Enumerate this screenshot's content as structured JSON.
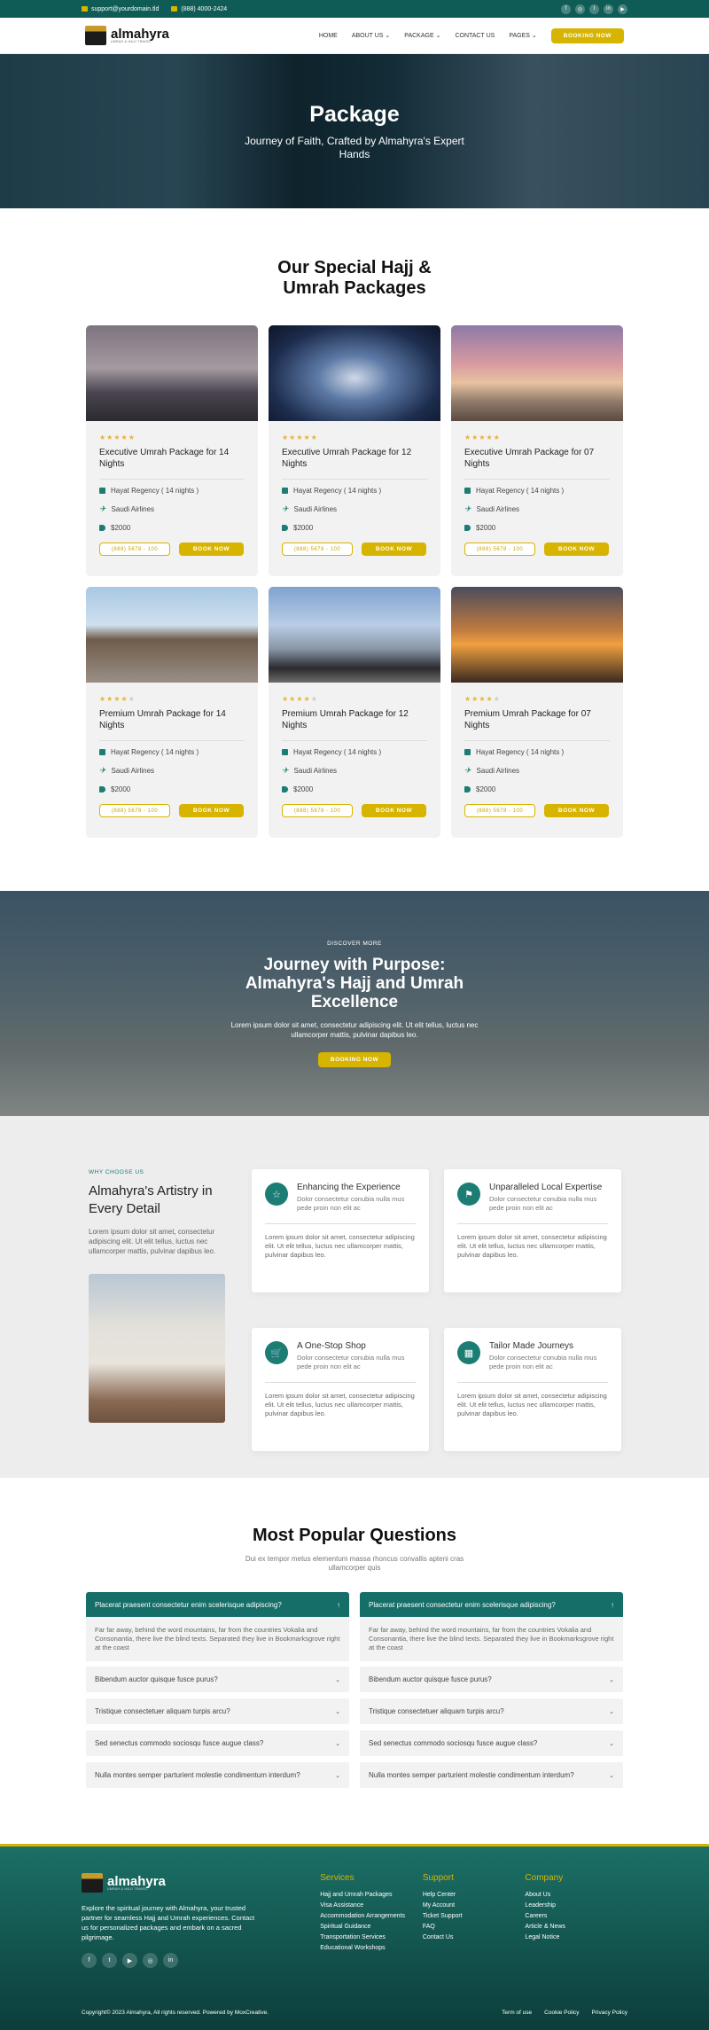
{
  "topbar": {
    "email": "support@yourdomain.tld",
    "phone": "(888) 4000-2424",
    "social": [
      "f",
      "◎",
      "t",
      "in",
      "▶"
    ]
  },
  "nav": {
    "brand": "almahyra",
    "tagline": "UMRAH & HAJJ TRAVEL",
    "items": [
      "HOME",
      "ABOUT US",
      "PACKAGE",
      "CONTACT US",
      "PAGES"
    ],
    "cta": "BOOKING NOW"
  },
  "hero": {
    "title": "Package",
    "subtitle": "Journey of Faith, Crafted by Almahyra's Expert Hands"
  },
  "packages": {
    "title": "Our Special Hajj & Umrah Packages",
    "cards": [
      {
        "stars": "★★★★★",
        "stars_off": "",
        "title": "Executive Umrah Package for 14 Nights",
        "hotel": "Hayat Regency ( 14 nights )",
        "airline": "Saudi Airlines",
        "price": "$2000",
        "phone": "(888) 5678 - 100",
        "book": "BOOK NOW"
      },
      {
        "stars": "★★★★★",
        "stars_off": "",
        "title": "Executive Umrah Package for 12 Nights",
        "hotel": "Hayat Regency ( 14 nights )",
        "airline": "Saudi Airlines",
        "price": "$2000",
        "phone": "(888) 5678 - 100",
        "book": "BOOK NOW"
      },
      {
        "stars": "★★★★★",
        "stars_off": "",
        "title": "Executive Umrah Package for 07 Nights",
        "hotel": "Hayat Regency ( 14 nights )",
        "airline": "Saudi Airlines",
        "price": "$2000",
        "phone": "(888) 5678 - 100",
        "book": "BOOK NOW"
      },
      {
        "stars": "★★★★",
        "stars_off": "★",
        "title": "Premium Umrah Package for 14 Nights",
        "hotel": "Hayat Regency ( 14 nights )",
        "airline": "Saudi Airlines",
        "price": "$2000",
        "phone": "(888) 5678 - 100",
        "book": "BOOK NOW"
      },
      {
        "stars": "★★★★",
        "stars_off": "★",
        "title": "Premium Umrah Package for 12 Nights",
        "hotel": "Hayat Regency ( 14 nights )",
        "airline": "Saudi Airlines",
        "price": "$2000",
        "phone": "(888) 5678 - 100",
        "book": "BOOK NOW"
      },
      {
        "stars": "★★★★",
        "stars_off": "★",
        "title": "Premium Umrah Package for 07 Nights",
        "hotel": "Hayat Regency ( 14 nights )",
        "airline": "Saudi Airlines",
        "price": "$2000",
        "phone": "(888) 5678 - 100",
        "book": "BOOK NOW"
      }
    ]
  },
  "banner": {
    "eyebrow": "DISCOVER MORE",
    "title": "Journey with Purpose: Almahyra's Hajj and Umrah Excellence",
    "text": "Lorem ipsum dolor sit amet, consectetur adipiscing elit. Ut elit tellus, luctus nec ullamcorper mattis, pulvinar dapibus leo.",
    "cta": "BOOKING NOW"
  },
  "why": {
    "label": "WHY CHOOSE US",
    "title": "Almahyra's Artistry in Every Detail",
    "text": "Lorem ipsum dolor sit amet, consectetur adipiscing elit. Ut elit tellus, luctus nec ullamcorper mattis, pulvinar dapibus leo.",
    "features": [
      {
        "icon": "☆",
        "title": "Enhancing the Experience",
        "sub": "Dolor consectetur conubia nulla mus pede proin non elit ac",
        "text": "Lorem ipsum dolor sit amet, consectetur adipiscing elit. Ut elit tellus, luctus nec ullamcorper mattis, pulvinar dapibus leo."
      },
      {
        "icon": "⚑",
        "title": "Unparalleled Local Expertise",
        "sub": "Dolor consectetur conubia nulla mus pede proin non elit ac",
        "text": "Lorem ipsum dolor sit amet, consectetur adipiscing elit. Ut elit tellus, luctus nec ullamcorper mattis, pulvinar dapibus leo."
      },
      {
        "icon": "🛒",
        "title": "A One-Stop Shop",
        "sub": "Dolor consectetur conubia nulla mus pede proin non elit ac",
        "text": "Lorem ipsum dolor sit amet, consectetur adipiscing elit. Ut elit tellus, luctus nec ullamcorper mattis, pulvinar dapibus leo."
      },
      {
        "icon": "▦",
        "title": "Tailor Made Journeys",
        "sub": "Dolor consectetur conubia nulla mus pede proin non elit ac",
        "text": "Lorem ipsum dolor sit amet, consectetur adipiscing elit. Ut elit tellus, luctus nec ullamcorper mattis, pulvinar dapibus leo."
      }
    ]
  },
  "faq": {
    "title": "Most Popular Questions",
    "sub": "Dui ex tempor metus elementum massa rhoncus convallis apteni cras ullamcorper quis",
    "open_q": "Placerat praesent consectetur enim scelerisque adipiscing?",
    "open_a": "Far far away, behind the word mountains, far from the countries Vokalia and Consonantia, there live the blind texts. Separated they live in Bookmarksgrove right at the coast",
    "questions": [
      "Bibendum auctor quisque fusce purus?",
      "Tristique consectetuer aliquam turpis arcu?",
      "Sed senectus commodo sociosqu fusce augue class?",
      "Nulla montes semper parturient molestie condimentum interdum?"
    ]
  },
  "footer": {
    "brand": "almahyra",
    "tagline": "UMRAH & HAJJ TRAVEL",
    "about": "Explore the spiritual journey with Almahyra, your trusted partner for seamless Hajj and Umrah experiences. Contact us for personalized packages and embark on a sacred pilgrimage.",
    "social": [
      "f",
      "t",
      "▶",
      "◎",
      "in"
    ],
    "services_title": "Services",
    "services": [
      "Hajj and Umrah Packages",
      "Visa Assistance",
      "Accommodation Arrangements",
      "Spiritual Guidance",
      "Transportation Services",
      "Educational Workshops"
    ],
    "support_title": "Support",
    "support": [
      "Help Center",
      "My Account",
      "Ticket Support",
      "FAQ",
      "Contact Us"
    ],
    "company_title": "Company",
    "company": [
      "About Us",
      "Leadership",
      "Careers",
      "Article & News",
      "Legal Notice"
    ],
    "copyright": "Copyright© 2023 Almahyra, All rights reserved. Powered by MoxCreative.",
    "legal": [
      "Term of use",
      "Cookie Policy",
      "Privacy Policy"
    ]
  },
  "colors": {
    "primary": "#1b7d73",
    "accent": "#d6b400"
  }
}
